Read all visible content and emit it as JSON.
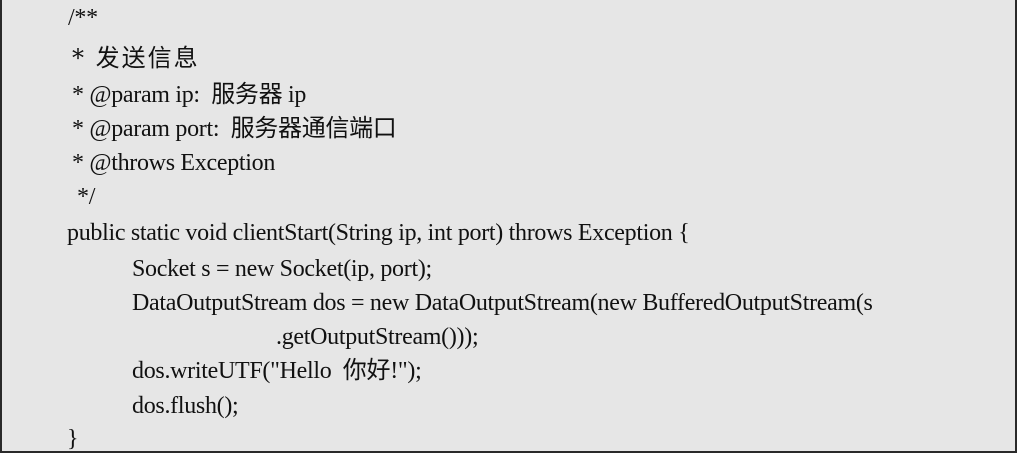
{
  "code": {
    "lines": [
      "/**",
      "* 发送信息",
      "* @param ip:  服务器 ip",
      "* @param port:  服务器通信端口",
      "* @throws Exception",
      "*/",
      "public static void clientStart(String ip, int port) throws Exception {",
      "Socket s = new Socket(ip, port);",
      "DataOutputStream dos = new DataOutputStream(new BufferedOutputStream(s",
      ".getOutputStream()));",
      "dos.writeUTF(\"Hello  你好!\");",
      "dos.flush();",
      "}"
    ]
  },
  "colors": {
    "background": "#e6e6e6",
    "text": "#111111",
    "border": "#2a2a2a"
  }
}
